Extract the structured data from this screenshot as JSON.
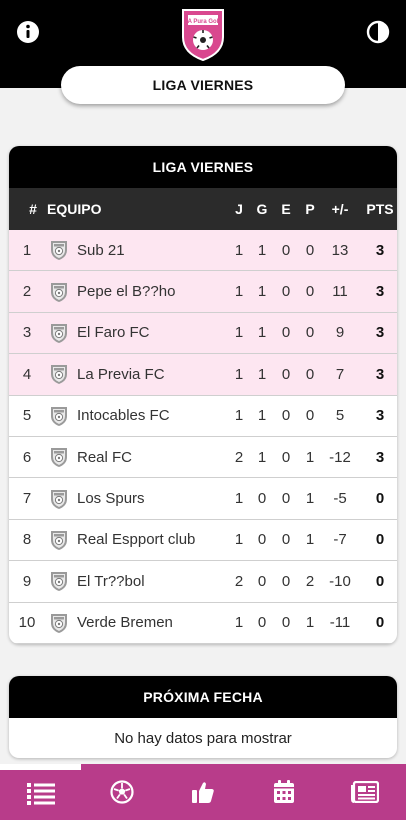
{
  "header": {
    "info_icon": "info-circle-icon",
    "logo_text": "A Pura Gol",
    "contrast_icon": "contrast-icon",
    "league_title": "LIGA VIERNES"
  },
  "standings": {
    "title": "LIGA VIERNES",
    "columns": {
      "pos": "#",
      "team": "EQUIPO",
      "j": "J",
      "g": "G",
      "e": "E",
      "p": "P",
      "diff": "+/-",
      "pts": "PTS"
    },
    "rows": [
      {
        "pos": "1",
        "team": "Sub 21",
        "j": "1",
        "g": "1",
        "e": "0",
        "p": "0",
        "diff": "13",
        "pts": "3"
      },
      {
        "pos": "2",
        "team": "Pepe el B??ho",
        "j": "1",
        "g": "1",
        "e": "0",
        "p": "0",
        "diff": "11",
        "pts": "3"
      },
      {
        "pos": "3",
        "team": "El Faro FC",
        "j": "1",
        "g": "1",
        "e": "0",
        "p": "0",
        "diff": "9",
        "pts": "3"
      },
      {
        "pos": "4",
        "team": "La Previa FC",
        "j": "1",
        "g": "1",
        "e": "0",
        "p": "0",
        "diff": "7",
        "pts": "3"
      },
      {
        "pos": "5",
        "team": "Intocables FC",
        "j": "1",
        "g": "1",
        "e": "0",
        "p": "0",
        "diff": "5",
        "pts": "3"
      },
      {
        "pos": "6",
        "team": "Real FC",
        "j": "2",
        "g": "1",
        "e": "0",
        "p": "1",
        "diff": "-12",
        "pts": "3"
      },
      {
        "pos": "7",
        "team": "Los Spurs",
        "j": "1",
        "g": "0",
        "e": "0",
        "p": "1",
        "diff": "-5",
        "pts": "0"
      },
      {
        "pos": "8",
        "team": "Real Espport club",
        "j": "1",
        "g": "0",
        "e": "0",
        "p": "1",
        "diff": "-7",
        "pts": "0"
      },
      {
        "pos": "9",
        "team": "El Tr??bol",
        "j": "2",
        "g": "0",
        "e": "0",
        "p": "2",
        "diff": "-10",
        "pts": "0"
      },
      {
        "pos": "10",
        "team": "Verde Bremen",
        "j": "1",
        "g": "0",
        "e": "0",
        "p": "1",
        "diff": "-11",
        "pts": "0"
      }
    ],
    "highlight_color": "#fde6f1"
  },
  "next_match": {
    "title": "PRÓXIMA FECHA",
    "empty_message": "No hay datos para mostrar"
  },
  "bottom_nav": {
    "tabs": [
      {
        "icon": "list-icon"
      },
      {
        "icon": "soccer-ball-icon"
      },
      {
        "icon": "thumbs-up-icon"
      },
      {
        "icon": "calendar-icon"
      },
      {
        "icon": "newspaper-icon"
      }
    ],
    "color": "#b83c8a"
  }
}
